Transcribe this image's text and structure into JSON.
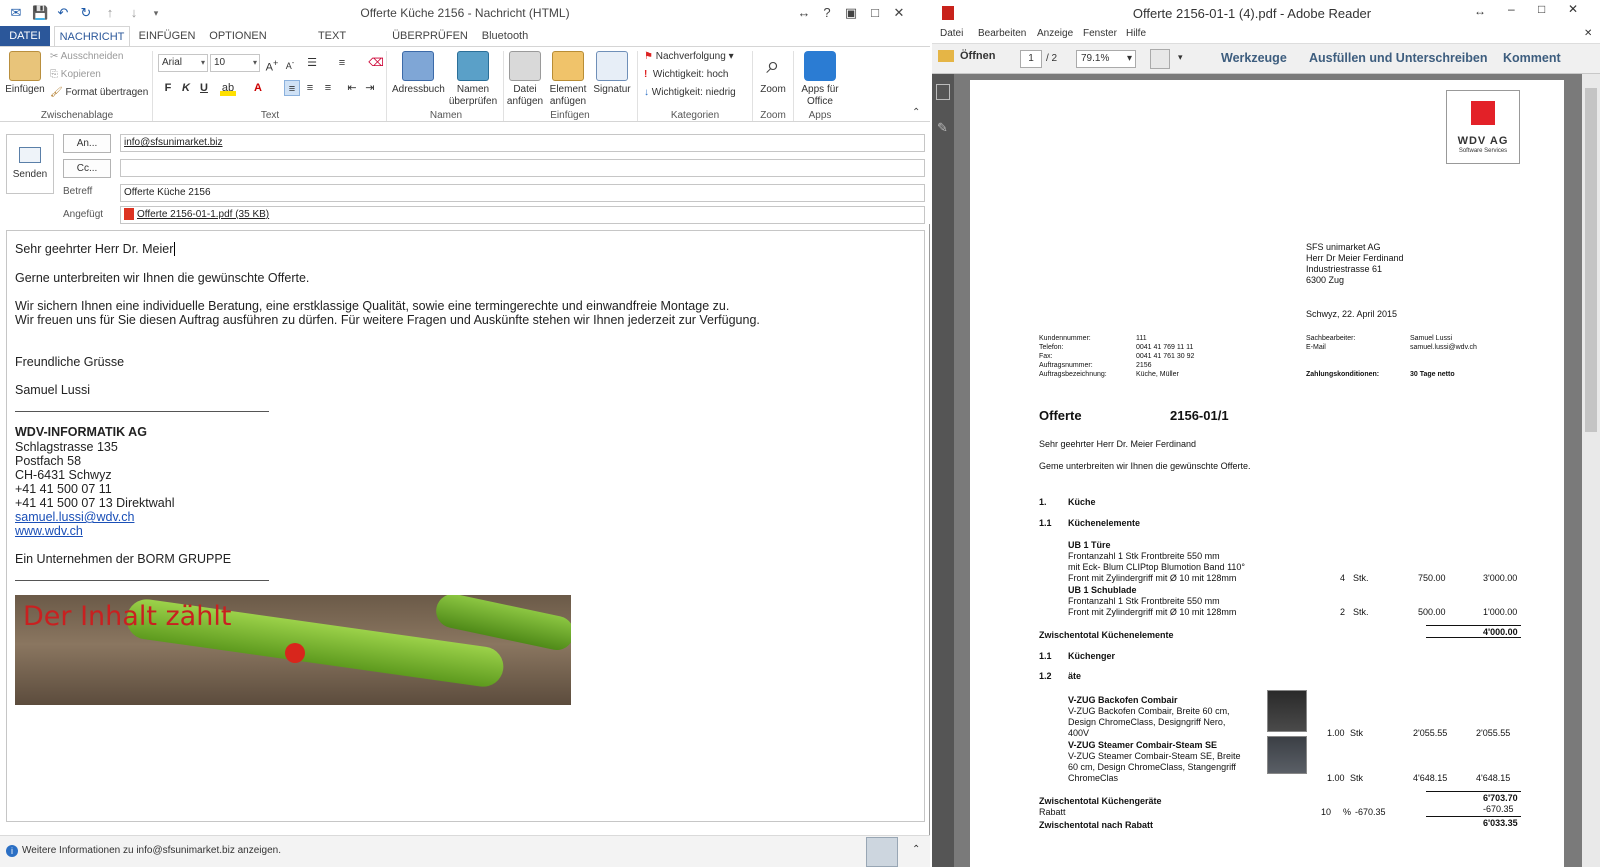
{
  "outlook": {
    "window_title": "Offerte Küche 2156 - Nachricht (HTML)",
    "tabs": [
      {
        "label": "DATEI"
      },
      {
        "label": "NACHRICHT"
      },
      {
        "label": "EINFÜGEN"
      },
      {
        "label": "OPTIONEN"
      },
      {
        "label": "TEXT FORMATIEREN"
      },
      {
        "label": "ÜBERPRÜFEN"
      },
      {
        "label": "Bluetooth"
      }
    ],
    "ribbon": {
      "clipboard": {
        "paste_label": "Einfügen",
        "cut_label": "Ausschneiden",
        "copy_label": "Kopieren",
        "format_painter_label": "Format übertragen",
        "group_label": "Zwischenablage"
      },
      "text": {
        "font_name": "Arial",
        "font_size": "10",
        "bold": "F",
        "italic": "K",
        "underline": "U",
        "group_label": "Text"
      },
      "names": {
        "address_book_label": "Adressbuch",
        "check_names_label_1": "Namen",
        "check_names_label_2": "überprüfen",
        "group_label": "Namen"
      },
      "include": {
        "attach_file_1": "Datei",
        "attach_file_2": "anfügen",
        "attach_item_1": "Element",
        "attach_item_2": "anfügen",
        "signature_label": "Signatur",
        "group_label": "Einfügen"
      },
      "tags": {
        "followup_label": "Nachverfolgung",
        "high_importance_label": "Wichtigkeit: hoch",
        "low_importance_label": "Wichtigkeit: niedrig",
        "group_label": "Kategorien"
      },
      "zoom": {
        "zoom_label": "Zoom",
        "group_label": "Zoom"
      },
      "apps": {
        "apps_label_1": "Apps für",
        "apps_label_2": "Office",
        "group_label": "Apps"
      }
    },
    "header": {
      "send_label": "Senden",
      "to_button": "An...",
      "cc_button": "Cc...",
      "to_value": "info@sfsunimarket.biz",
      "cc_value": "",
      "subject_label": "Betreff",
      "subject_value": "Offerte Küche 2156",
      "attached_label": "Angefügt",
      "attachment_name": "Offerte 2156-01-1.pdf (35 KB)"
    },
    "body": {
      "salutation": "Sehr geehrter Herr Dr. Meier",
      "line1": "Gerne unterbreiten wir Ihnen die gewünschte Offerte.",
      "line2": "Wir sichern Ihnen eine individuelle Beratung, eine erstklassige Qualität, sowie eine termingerechte und einwandfreie Montage zu.",
      "line3": "Wir freuen uns für Sie diesen Auftrag ausführen zu dürfen. Für weitere Fragen und Auskünfte stehen wir Ihnen jederzeit zur Verfügung.",
      "greeting": "Freundliche Grüsse",
      "sender": "Samuel Lussi",
      "company": "WDV-INFORMATIK AG",
      "street": "Schlagstrasse 135",
      "postbox": "Postfach 58",
      "city": "CH-6431 Schwyz",
      "phone": "+41 41 500 07 11",
      "direct": "+41 41 500 07 13 Direktwahl",
      "email": "samuel.lussi@wdv.ch",
      "web": "www.wdv.ch",
      "group": "Ein Unternehmen der BORM GRUPPE",
      "banner_text": "Der Inhalt zählt"
    },
    "status_text": "Weitere Informationen zu info@sfsunimarket.biz anzeigen."
  },
  "reader": {
    "window_title": "Offerte 2156-01-1 (4).pdf - Adobe Reader",
    "menu": [
      "Datei",
      "Bearbeiten",
      "Anzeige",
      "Fenster",
      "Hilfe"
    ],
    "open_label": "Öffnen",
    "page_current": "1",
    "page_total": "/ 2",
    "zoom_value": "79.1%",
    "tools_label": "Werkzeuge",
    "fill_sign_label": "Ausfüllen und Unterschreiben",
    "comment_label": "Komment",
    "doc": {
      "logo_text": "WDV AG",
      "logo_sub": "Software Services",
      "recipient": [
        "SFS unimarket AG",
        "Herr Dr Meier Ferdinand",
        "Industriestrasse 61",
        "6300 Zug"
      ],
      "date_line": "Schwyz, 22. April 2015",
      "meta_labels": [
        "Kundennummer:",
        "Telefon:",
        "Fax:",
        "Auftragsnummer:",
        "Auftragsbezeichnung:"
      ],
      "meta_values": [
        "111",
        "0041 41 769 11 11",
        "0041 41 761 30 92",
        "2156",
        "Küche, Müller"
      ],
      "meta2_labels": [
        "Sachbearbeiter:",
        "E-Mail"
      ],
      "meta2_values": [
        "Samuel Lussi",
        "samuel.lussi@wdv.ch"
      ],
      "payment_label": "Zahlungskonditionen:",
      "payment_value": "30 Tage netto",
      "offer_title": "Offerte",
      "offer_number": "2156-01/1",
      "salutation": "Sehr geehrter Herr Dr. Meier Ferdinand",
      "intro": "Geme unterbreiten wir Ihnen die gewünschte Offerte.",
      "sec1_num": "1.",
      "sec1_title": "Küche",
      "sec11_num": "1.1",
      "sec11_title": "Küchenelemente",
      "item1_title": "UB 1 Türe",
      "item1_l1": "Frontanzahl 1 Stk Frontbreite 550 mm",
      "item1_l2": "mit Eck- Blum CLIPtop Blumotion Band 110°",
      "item1_l3": "Front mit Zylindergriff mit Ø 10 mit 128mm",
      "item1_qty": "4",
      "item1_unit": "Stk.",
      "item1_price": "750.00",
      "item1_total": "3'000.00",
      "item2_title": "UB 1 Schublade",
      "item2_l1": "Frontanzahl 1 Stk Frontbreite 550 mm",
      "item2_l2": "Front mit Zylindergriff mit Ø 10 mit 128mm",
      "item2_qty": "2",
      "item2_unit": "Stk.",
      "item2_price": "500.00",
      "item2_total": "1'000.00",
      "subtotal1_label": "Zwischentotal Küchenelemente",
      "subtotal1_value": "4'000.00",
      "sec12a_num": "1.1",
      "sec12a_title": "Küchenger",
      "sec12b_num": "1.2",
      "sec12b_title": "äte",
      "item3_title": "V-ZUG Backofen Combair",
      "item3_l1": "V-ZUG Backofen Combair, Breite 60 cm,",
      "item3_l2": "Design ChromeClass, Designgriff Nero,",
      "item3_l3": "400V",
      "item3_qty": "1.00",
      "item3_unit": "Stk",
      "item3_price": "2'055.55",
      "item3_total": "2'055.55",
      "item4_title": "V-ZUG Steamer Combair-Steam SE",
      "item4_l1": "V-ZUG Steamer Combair-Steam SE, Breite",
      "item4_l2": "60 cm, Design ChromeClass, Stangengriff",
      "item4_l3": "ChromeClas",
      "item4_qty": "1.00",
      "item4_unit": "Stk",
      "item4_price": "4'648.15",
      "item4_total": "4'648.15",
      "subtotal2_label": "Zwischentotal Küchengeräte",
      "subtotal2_value": "6'703.70",
      "discount_label": "Rabatt",
      "discount_pct": "10",
      "discount_pct_unit": "%",
      "discount_amount": "-670.35",
      "discount_value": "-670.35",
      "subtotal3_label": "Zwischentotal nach Rabatt",
      "subtotal3_value": "6'033.35"
    }
  }
}
